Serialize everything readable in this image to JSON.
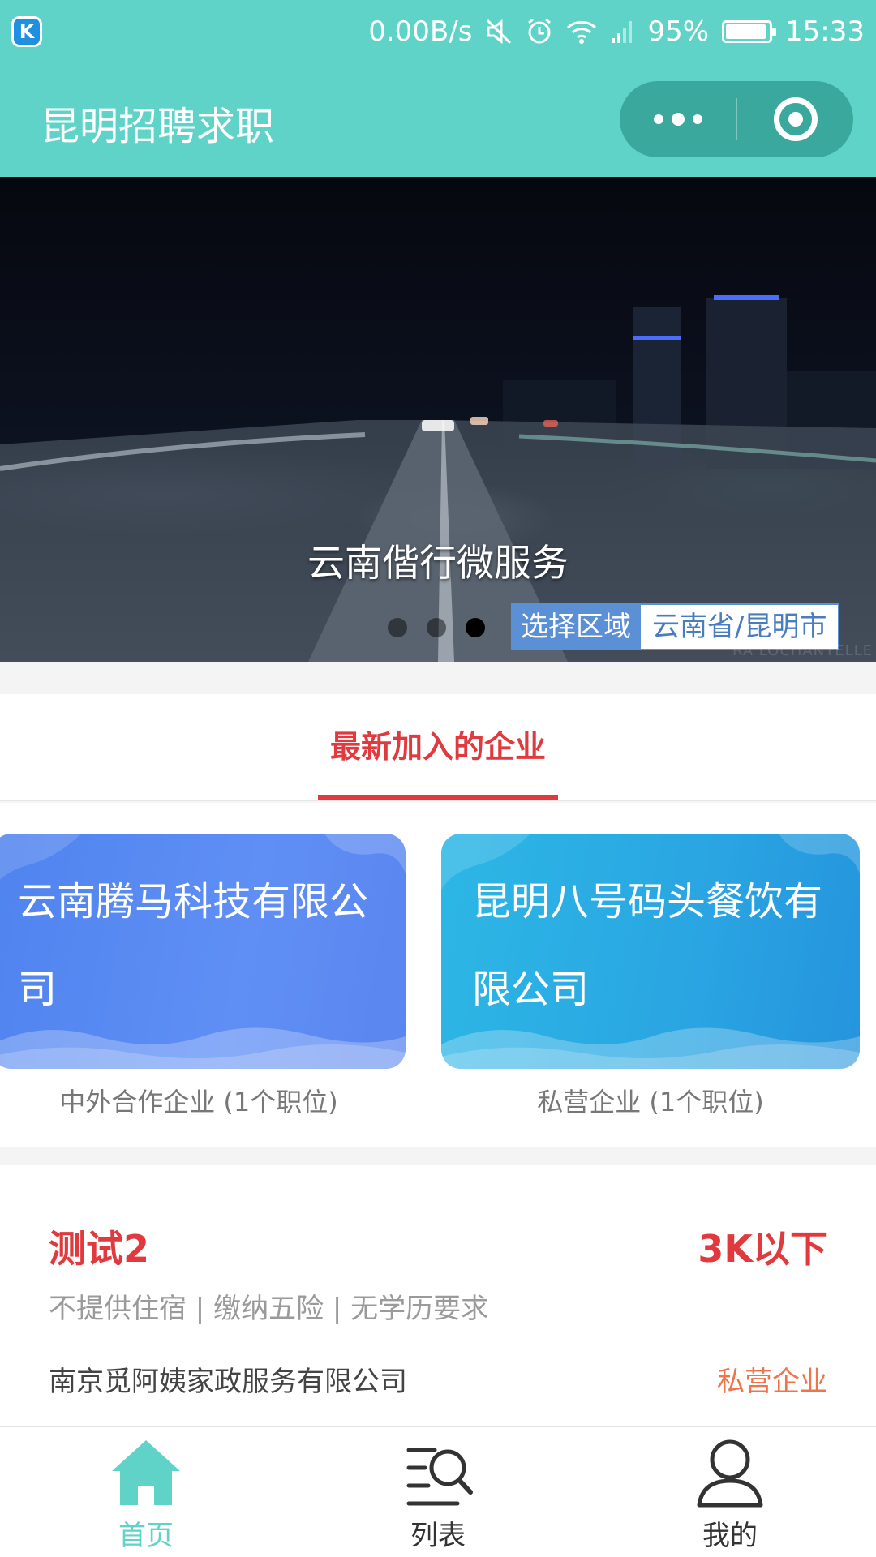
{
  "status_bar": {
    "net_speed": "0.00B/s",
    "battery": "95%",
    "battery_level": 0.95,
    "time": "15:33",
    "app_icon_letter": "K"
  },
  "header": {
    "title": "昆明招聘求职",
    "bg_color": "#5fd3c7"
  },
  "banner": {
    "caption": "云南偕行微服务",
    "dots": 3,
    "active_dot": 3,
    "region_label": "选择区域",
    "region_value": "云南省/昆明市",
    "watermark": "RA LOCHANTELLE"
  },
  "section_tab": {
    "label": "最新加入的企业",
    "accent": "#e03a3e"
  },
  "companies": [
    {
      "name": "云南腾马科技有限公司",
      "subtitle": "中外合作企业 (1个职位)"
    },
    {
      "name": "昆明八号码头餐饮有限公司",
      "subtitle": "私营企业 (1个职位)"
    }
  ],
  "job": {
    "title": "测试2",
    "salary": "3K以下",
    "tags": "不提供住宿 | 缴纳五险 | 无学历要求",
    "company": "南京觅阿姨家政服务有限公司",
    "company_type": "私营企业"
  },
  "bottom_nav": [
    {
      "label": "首页",
      "icon": "home-icon",
      "active": true
    },
    {
      "label": "列表",
      "icon": "search-list-icon",
      "active": false
    },
    {
      "label": "我的",
      "icon": "user-icon",
      "active": false
    }
  ]
}
